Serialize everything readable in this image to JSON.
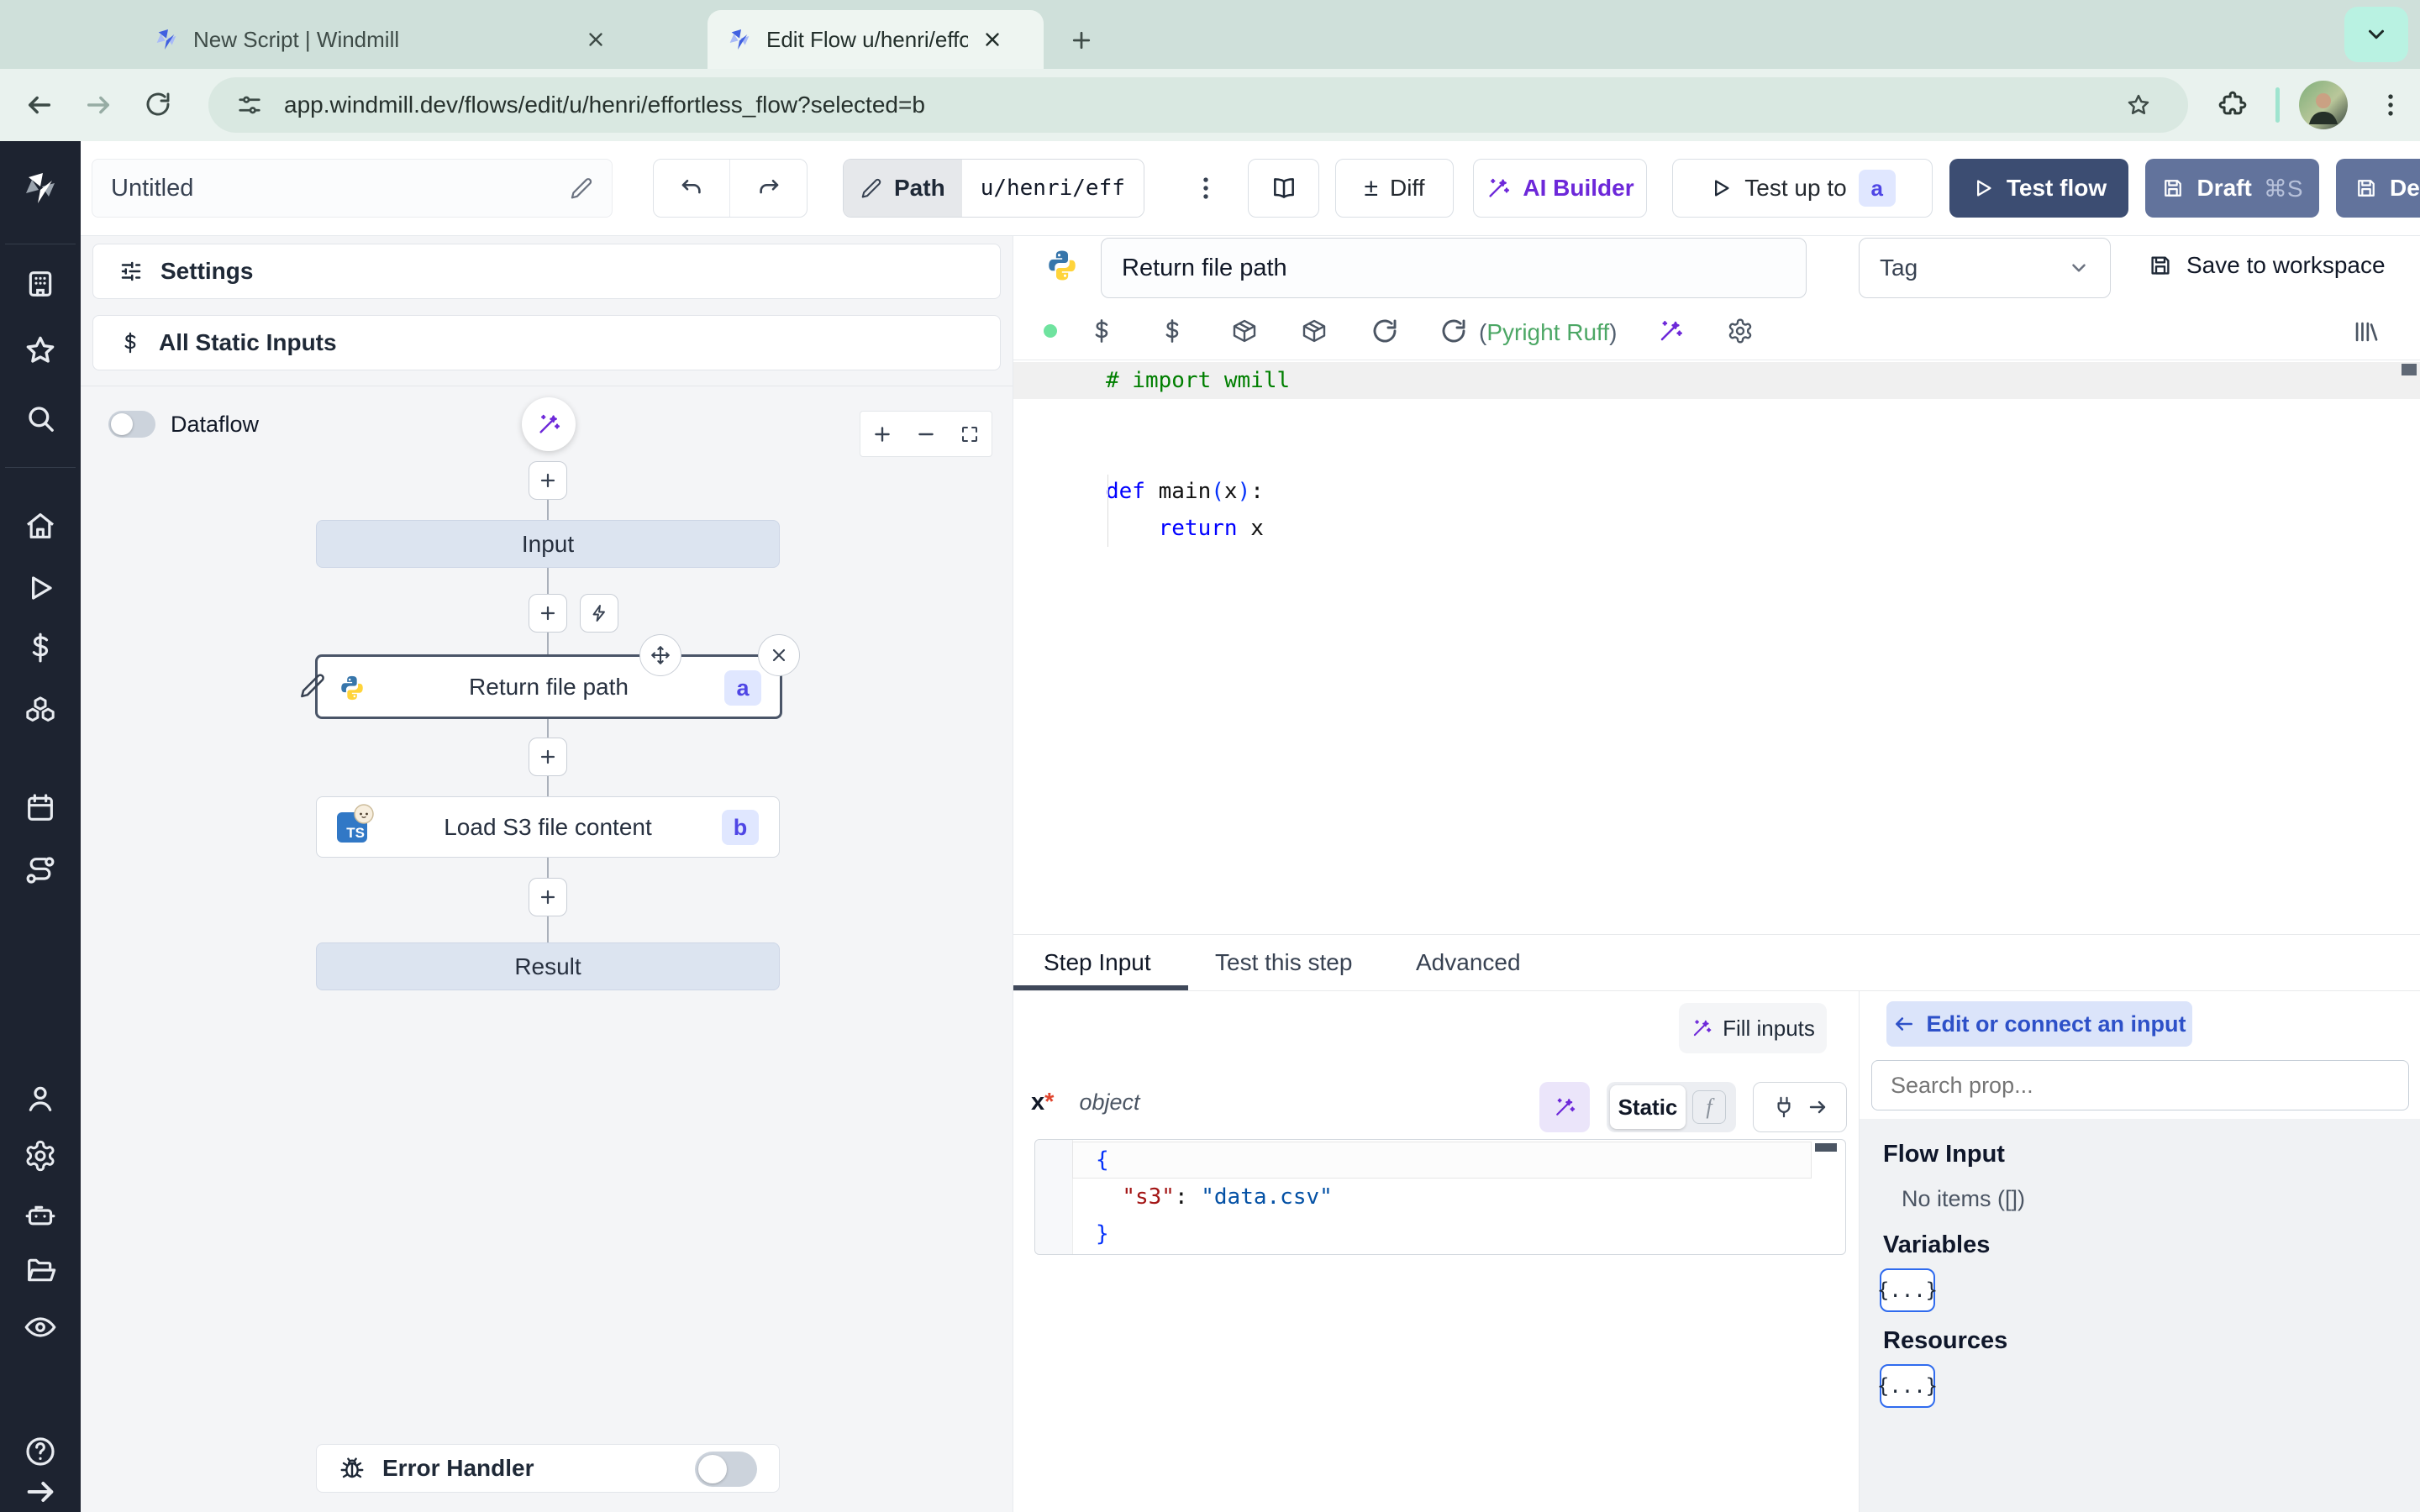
{
  "browser": {
    "tab1_title": "New Script | Windmill",
    "tab2_title": "Edit Flow u/henri/effortless_fl",
    "url": "app.windmill.dev/flows/edit/u/henri/effortless_flow?selected=b"
  },
  "toolbar": {
    "flow_name": "Untitled",
    "path_label": "Path",
    "path_value": "u/henri/eff",
    "plus_minus": "±",
    "diff_label": "Diff",
    "ai_builder_label": "AI Builder",
    "test_up_to_label": "Test up to",
    "test_up_to_badge": "a",
    "test_flow_label": "Test flow",
    "draft_label": "Draft",
    "draft_shortcut": "⌘S",
    "deploy_label": "Deploy"
  },
  "left_panel": {
    "settings_label": "Settings",
    "static_inputs_label": "All Static Inputs",
    "dataflow_label": "Dataflow",
    "input_node": "Input",
    "step_a_title": "Return file path",
    "step_a_badge": "a",
    "step_b_title": "Load S3 file content",
    "step_b_badge": "b",
    "ts_logo_text": "TS",
    "result_node": "Result",
    "error_handler_label": "Error Handler"
  },
  "editor": {
    "step_name": "Return file path",
    "tag_placeholder": "Tag",
    "save_label": "Save to workspace",
    "lint_open": "(",
    "lint_name": "Pyright Ruff",
    "lint_close": ")",
    "python_code": [
      [
        {
          "c": "comment",
          "t": "# import wmill"
        }
      ],
      [],
      [],
      [
        {
          "c": "kw",
          "t": "def"
        },
        {
          "c": "plain",
          "t": " main"
        },
        {
          "c": "paren",
          "t": "("
        },
        {
          "c": "plain",
          "t": "x"
        },
        {
          "c": "paren",
          "t": ")"
        },
        {
          "c": "plain",
          "t": ":"
        }
      ],
      [
        {
          "c": "plain",
          "t": "    "
        },
        {
          "c": "kw",
          "t": "return"
        },
        {
          "c": "plain",
          "t": " x"
        }
      ]
    ]
  },
  "bottom": {
    "tab_step_input": "Step Input",
    "tab_test_step": "Test this step",
    "tab_advanced": "Advanced",
    "fill_inputs_label": "Fill inputs",
    "arg_name": "x",
    "arg_required": "*",
    "arg_type": "object",
    "static_label": "Static",
    "fx_label": "f",
    "json_value": [
      [
        {
          "c": "brace",
          "t": "{"
        }
      ],
      [
        {
          "c": "plain",
          "t": "  "
        },
        {
          "c": "key",
          "t": "\"s3\""
        },
        {
          "c": "plain",
          "t": ": "
        },
        {
          "c": "str",
          "t": "\"data.csv\""
        }
      ],
      [
        {
          "c": "brace",
          "t": "}"
        }
      ]
    ],
    "connect_back_label": "Edit or connect an input",
    "search_placeholder": "Search prop...",
    "flow_input_label": "Flow Input",
    "flow_input_empty": "No items ([])",
    "variables_label": "Variables",
    "resources_label": "Resources",
    "braces_label": "{...}"
  },
  "colors": {
    "chrome_tabstrip": "#cfe0da",
    "chrome_toolbar": "#e9f2ee",
    "mint_accent": "#b9f2e2",
    "rail_dark": "#1d2330",
    "navy_button": "#3c4d72",
    "slate_button": "#62739c",
    "purple_accent": "#7c3aed",
    "badge_bg": "#e0e7ff",
    "badge_text": "#4f46e5",
    "lint_green": "#4ca765",
    "status_green": "#6fe39f",
    "connect_pill_bg": "#dbe4fa",
    "connect_pill_text": "#2d50c8"
  },
  "icons": [
    "windmill-logo",
    "workspace-icon",
    "favorites-star-icon",
    "search-icon",
    "home-icon",
    "runs-play-icon",
    "variables-dollar-icon",
    "resources-boxes-icon",
    "schedules-calendar-icon",
    "flows-route-icon",
    "user-icon",
    "settings-gear-icon",
    "workers-robot-icon",
    "folders-icon",
    "audit-eye-icon",
    "help-icon",
    "expand-arrow-icon",
    "pencil-icon",
    "undo-icon",
    "redo-icon",
    "kebab-icon",
    "book-icon",
    "wand-icon",
    "play-icon",
    "save-icon",
    "sliders-icon",
    "dollar-icon",
    "bolt-icon",
    "move-icon",
    "close-icon",
    "bug-icon",
    "refresh-icon",
    "gear-icon",
    "library-icon",
    "package-icon",
    "plug-icon",
    "arrow-right-icon",
    "arrow-left-icon",
    "chevron-down-icon",
    "star-icon",
    "puzzle-icon",
    "tune-icon",
    "plus-icon",
    "minus-icon",
    "fullscreen-icon",
    "python-logo",
    "typescript-logo",
    "bun-logo",
    "green-status-dot",
    "avatar"
  ]
}
